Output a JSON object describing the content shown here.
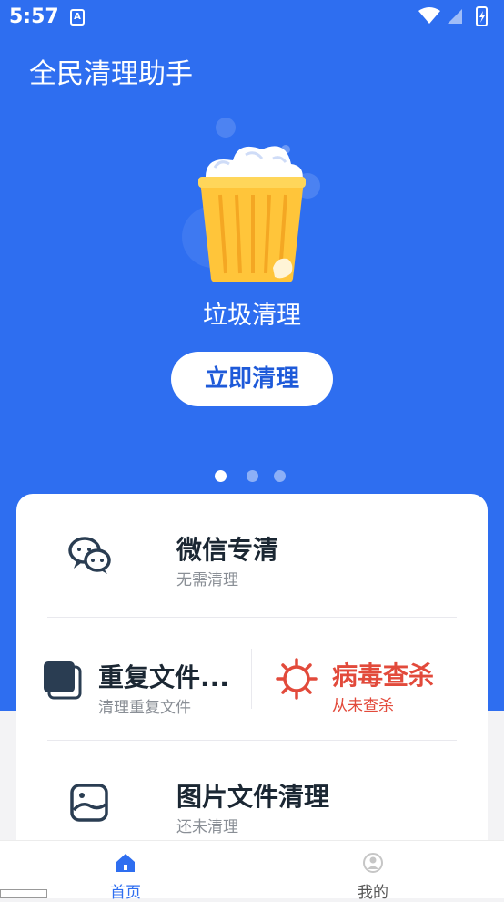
{
  "status_bar": {
    "time": "5:57",
    "notification_letter": "A"
  },
  "app": {
    "title": "全民清理助手"
  },
  "hero": {
    "label": "垃圾清理",
    "button_label": "立即清理",
    "page_count": 3,
    "active_page": 0
  },
  "features": {
    "wechat": {
      "title": "微信专清",
      "subtitle": "无需清理",
      "icon": "wechat-icon"
    },
    "duplicate": {
      "title": "重复文件...",
      "subtitle": "清理重复文件",
      "icon": "duplicate-files-icon"
    },
    "virus": {
      "title": "病毒查杀",
      "subtitle": "从未查杀",
      "icon": "virus-icon"
    },
    "image": {
      "title": "图片文件清理",
      "subtitle": "还未清理",
      "icon": "image-file-icon"
    }
  },
  "bottom_nav": {
    "home": {
      "label": "首页",
      "icon": "home-icon"
    },
    "mine": {
      "label": "我的",
      "icon": "user-icon"
    }
  },
  "colors": {
    "primary": "#2e6ef0",
    "accent_red": "#e24a3b",
    "button_text": "#1e5ad9"
  }
}
